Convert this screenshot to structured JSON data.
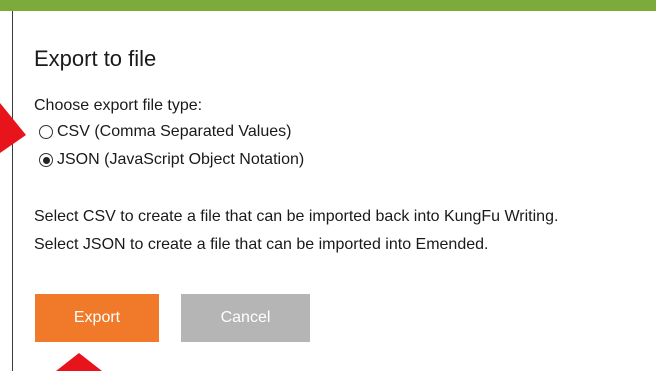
{
  "dialog": {
    "title": "Export to file",
    "prompt": "Choose export file type:",
    "options": [
      {
        "label": "CSV (Comma Separated Values)",
        "checked": false
      },
      {
        "label": "JSON (JavaScript Object Notation)",
        "checked": true
      }
    ],
    "description": [
      "Select CSV to create a file that can be imported back into KungFu Writing.",
      "Select JSON to create a file that can be imported into Emended."
    ],
    "buttons": {
      "export_label": "Export",
      "cancel_label": "Cancel"
    }
  },
  "colors": {
    "top_bar": "#7cab3c",
    "export_button": "#f07a2a",
    "cancel_button": "#b5b5b5",
    "annotation_arrow": "#e8141c"
  },
  "icons": {
    "left_arrow": "arrow-right-icon",
    "bottom_arrow": "arrow-up-icon"
  }
}
